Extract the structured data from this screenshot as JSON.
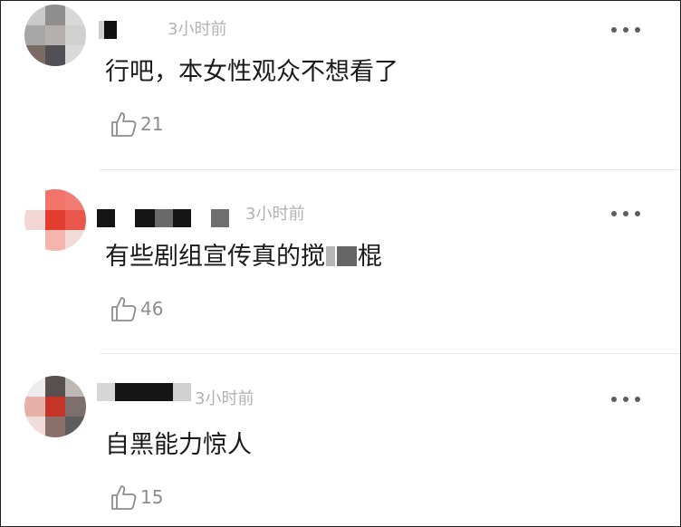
{
  "comments": [
    {
      "time": "3小时前",
      "text": "行吧，本女性观众不想看了",
      "likes": "21",
      "avatar_colors": [
        "#c9c9c9",
        "#8e8e8e",
        "#d8d8d8",
        "#a6a6a6",
        "#b5b0ae",
        "#d0d0d0",
        "#7a6b64",
        "#505055",
        "#d9d9d9"
      ],
      "more_icon": "more-dots-icon",
      "like_icon": "thumbs-up-icon"
    },
    {
      "time": "3小时前",
      "text_before": "有些剧组宣传真的搅",
      "text_after": "棍",
      "likes": "46",
      "avatar_colors": [
        "#ffffff",
        "#f0746a",
        "#f07b72",
        "#f2d6d3",
        "#e33b2d",
        "#e9574c",
        "#ffffff",
        "#f5b5ae",
        "#f3dbd8"
      ],
      "more_icon": "more-dots-icon",
      "like_icon": "thumbs-up-icon"
    },
    {
      "time": "3小时前",
      "text": "自黑能力惊人",
      "likes": "15",
      "avatar_colors": [
        "#ececec",
        "#5a4f4f",
        "#bdb7b5",
        "#e6b0a8",
        "#c43527",
        "#7d6f6b",
        "#f0dcd8",
        "#8a6f6a",
        "#5f5c5e"
      ],
      "more_icon": "more-dots-icon",
      "like_icon": "thumbs-up-icon"
    }
  ]
}
